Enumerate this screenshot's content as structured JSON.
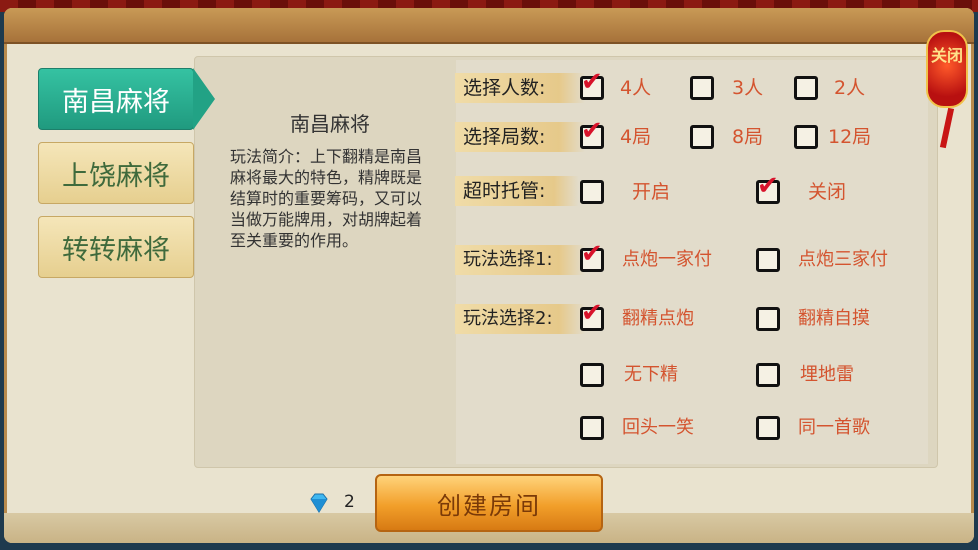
{
  "close_button": {
    "label": "关闭"
  },
  "tabs": [
    {
      "label": "南昌麻将",
      "active": true
    },
    {
      "label": "上饶麻将",
      "active": false
    },
    {
      "label": "转转麻将",
      "active": false
    }
  ],
  "description": {
    "title": "南昌麻将",
    "text": "玩法简介：上下翻精是南昌麻将最大的特色，精牌既是结算时的重要筹码，又可以当做万能牌用，对胡牌起着至关重要的作用。"
  },
  "options": {
    "players": {
      "label": "选择人数:",
      "choices": [
        {
          "text": "4人",
          "checked": true
        },
        {
          "text": "3人",
          "checked": false
        },
        {
          "text": "2人",
          "checked": false
        }
      ]
    },
    "rounds": {
      "label": "选择局数:",
      "choices": [
        {
          "text": "4局",
          "checked": true
        },
        {
          "text": "8局",
          "checked": false
        },
        {
          "text": "12局",
          "checked": false
        }
      ]
    },
    "timeout": {
      "label": "超时托管:",
      "choices": [
        {
          "text": "开启",
          "checked": false
        },
        {
          "text": "关闭",
          "checked": true
        }
      ]
    },
    "play1": {
      "label": "玩法选择1:",
      "choices": [
        {
          "text": "点炮一家付",
          "checked": true
        },
        {
          "text": "点炮三家付",
          "checked": false
        }
      ]
    },
    "play2": {
      "label": "玩法选择2:",
      "choices": [
        {
          "text": "翻精点炮",
          "checked": true
        },
        {
          "text": "翻精自摸",
          "checked": false
        },
        {
          "text": "无下精",
          "checked": false
        },
        {
          "text": "埋地雷",
          "checked": false
        },
        {
          "text": "回头一笑",
          "checked": false
        },
        {
          "text": "同一首歌",
          "checked": false
        }
      ]
    }
  },
  "footer": {
    "diamond_count": "2",
    "create_label": "创建房间"
  },
  "tick_glyph": "✔"
}
